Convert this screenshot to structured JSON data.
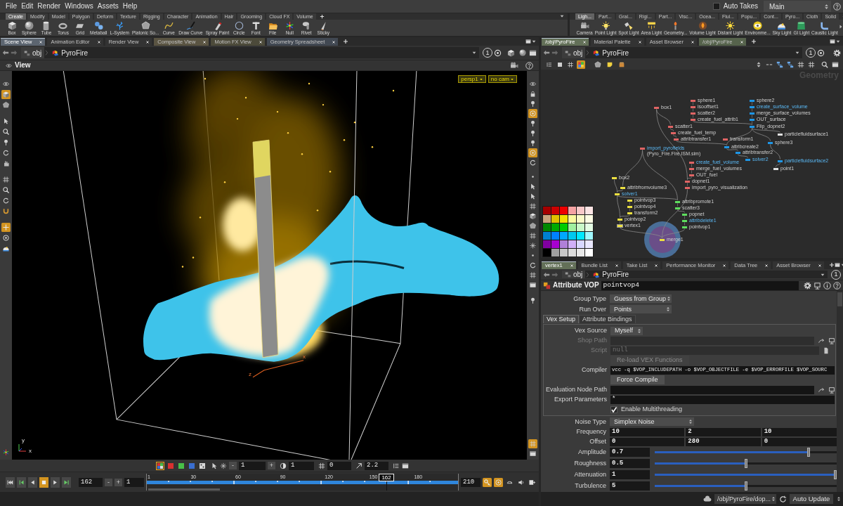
{
  "menu_bar": {
    "items": [
      "File",
      "Edit",
      "Render",
      "Windows",
      "Assets",
      "Help"
    ],
    "auto_takes": {
      "label": "Auto Takes",
      "checked": false
    },
    "desktop": "Main"
  },
  "shelf_left": {
    "tabs": [
      {
        "label": "Create",
        "selected": true
      },
      {
        "label": "Modify",
        "selected": false
      },
      {
        "label": "Model",
        "selected": false
      },
      {
        "label": "Polygon",
        "selected": false
      },
      {
        "label": "Deform",
        "selected": false
      },
      {
        "label": "Texture",
        "selected": false
      },
      {
        "label": "Rigging",
        "selected": false
      },
      {
        "label": "Character",
        "selected": false
      },
      {
        "label": "Animation",
        "selected": false
      },
      {
        "label": "Hair",
        "selected": false
      },
      {
        "label": "Grooming",
        "selected": false
      },
      {
        "label": "Cloud FX",
        "selected": false
      },
      {
        "label": "Volume",
        "selected": false
      }
    ],
    "tools": [
      "Box",
      "Sphere",
      "Tube",
      "Torus",
      "Grid",
      "Metaball",
      "L-System",
      "Platonic So...",
      "Curve",
      "Draw Curve",
      "Spray Paint",
      "Circle",
      "Font",
      "File",
      "Null",
      "Rivet",
      "Sticky"
    ]
  },
  "shelf_right": {
    "tabs": [
      {
        "label": "Ligh...",
        "selected": true
      },
      {
        "label": "Part...",
        "selected": false
      },
      {
        "label": "Grai...",
        "selected": false
      },
      {
        "label": "Rigi...",
        "selected": false
      },
      {
        "label": "Part...",
        "selected": false
      },
      {
        "label": "Visc...",
        "selected": false
      },
      {
        "label": "Ocea...",
        "selected": false
      },
      {
        "label": "Flui...",
        "selected": false
      },
      {
        "label": "Popu...",
        "selected": false
      },
      {
        "label": "Cont...",
        "selected": false
      },
      {
        "label": "Pyro...",
        "selected": false
      },
      {
        "label": "Cloth",
        "selected": false
      },
      {
        "label": "Solid",
        "selected": false
      }
    ],
    "tools": [
      "Camera",
      "Point Light",
      "Spot Light",
      "Area Light",
      "Geometry...",
      "Volume Light",
      "Distant Light",
      "Environme...",
      "Sky Light",
      "GI Light",
      "Caustic Light"
    ]
  },
  "scene_view": {
    "tabs": [
      {
        "label": "Scene View",
        "selected": true,
        "color": "#5c6570"
      },
      {
        "label": "Animation Editor",
        "selected": false,
        "color": "#333333"
      },
      {
        "label": "Render View",
        "selected": false,
        "color": "#333333"
      },
      {
        "label": "Composite View",
        "selected": false,
        "color": "#5a5442"
      },
      {
        "label": "Motion FX View",
        "selected": false,
        "color": "#4c4a3a"
      },
      {
        "label": "Geometry Spreadsheet",
        "selected": false,
        "color": "#414852"
      }
    ],
    "path": [
      "obj",
      "PyroFire"
    ],
    "link": "1",
    "title": "View",
    "camera": "persp1",
    "camera_menu": "no cam",
    "left_tools": [
      {
        "selected": false
      },
      {
        "selected": true
      },
      {
        "selected": false
      },
      {
        "selected": false
      },
      {
        "selected": false
      },
      {
        "selected": false
      },
      {
        "selected": false
      },
      {
        "selected": false
      },
      {
        "selected": false
      },
      {
        "selected": false
      },
      {
        "selected": false
      },
      {
        "selected": false
      },
      {
        "selected": true
      },
      {
        "selected": false
      },
      {
        "selected": false
      },
      {
        "selected": false
      }
    ],
    "right_tools": [
      {
        "selected": false
      },
      {
        "selected": false
      },
      {
        "selected": false
      },
      {
        "selected": true
      },
      {
        "selected": false
      },
      {
        "selected": false
      },
      {
        "selected": false
      },
      {
        "selected": true
      },
      {
        "selected": false
      },
      {
        "selected": false
      },
      {
        "selected": false
      },
      {
        "selected": false
      },
      {
        "selected": false
      },
      {
        "selected": false
      },
      {
        "selected": false
      },
      {
        "selected": false
      },
      {
        "selected": false
      },
      {
        "selected": false
      },
      {
        "selected": false
      },
      {
        "selected": false
      },
      {
        "selected": false
      },
      {
        "selected": false
      },
      {
        "selected": true
      },
      {
        "selected": false
      }
    ],
    "handle_axes": [
      "x",
      "z"
    ],
    "axis_labels": [
      "y",
      "x"
    ]
  },
  "display_bar": {
    "channels": [
      {
        "selected": true
      },
      {
        "selected": false
      },
      {
        "selected": false
      },
      {
        "selected": false
      },
      {
        "selected": false
      }
    ],
    "step_buttons": [
      "-",
      "+"
    ],
    "fields": [
      "1",
      "1",
      "0",
      "2.2"
    ]
  },
  "timeline": {
    "buttons": [
      {
        "selected": false
      },
      {
        "selected": false
      },
      {
        "selected": false
      },
      {
        "selected": true
      },
      {
        "selected": false
      },
      {
        "selected": false
      }
    ],
    "frame": "162",
    "step_buttons": [
      "-",
      "+"
    ],
    "start": "1",
    "ticks": [
      "1",
      "30",
      "60",
      "90",
      "120",
      "150",
      "180"
    ],
    "marker": "162",
    "level": 0.77,
    "end": "210",
    "options": [
      {
        "selected": true
      },
      {
        "selected": true
      },
      {
        "selected": false
      },
      {
        "selected": false
      },
      {
        "selected": false
      }
    ]
  },
  "network": {
    "tabs": [
      {
        "label": "/obj/PyroFire",
        "selected": true,
        "color": "#637058"
      },
      {
        "label": "Material Palette",
        "selected": false,
        "color": "#333333"
      },
      {
        "label": "Asset Browser",
        "selected": false,
        "color": "#333333"
      },
      {
        "label": "/obj/PyroFire",
        "selected": false,
        "color": "#56634c"
      }
    ],
    "path": [
      "obj",
      "PyroFire"
    ],
    "link": "1",
    "view_modes": [
      {
        "selected": false
      },
      {
        "selected": false
      },
      {
        "selected": false
      },
      {
        "selected": true
      }
    ],
    "context": "Geometry",
    "nodes": [
      {
        "label": "box1",
        "color": "#e06464",
        "highlighted": false,
        "selected": false
      },
      {
        "label": "sphere1",
        "color": "#e06464",
        "highlighted": false,
        "selected": false
      },
      {
        "label": "isooffset1",
        "color": "#e06464",
        "highlighted": false,
        "selected": false
      },
      {
        "label": "scatter2",
        "color": "#e06464",
        "highlighted": false,
        "selected": false
      },
      {
        "label": "create_fuel_attrib1",
        "color": "#e06464",
        "highlighted": false,
        "selected": false
      },
      {
        "label": "scatter1",
        "color": "#e06464",
        "highlighted": false,
        "selected": false
      },
      {
        "label": "create_fuel_temp",
        "color": "#e06464",
        "highlighted": false,
        "selected": false
      },
      {
        "label": "transform1",
        "color": "#e06464",
        "highlighted": false,
        "selected": false
      },
      {
        "label": "attribtransfer1",
        "color": "#e06464",
        "highlighted": false,
        "selected": false
      },
      {
        "label": "import_pyrofields",
        "comment": "(Pyro_Fire.Fire.ISM.sim)",
        "color": "#e06464",
        "highlighted": true,
        "selected": false
      },
      {
        "label": "create_fuel_volume",
        "color": "#e06464",
        "highlighted": true,
        "selected": false
      },
      {
        "label": "merge_fuel_volumes",
        "color": "#e06464",
        "highlighted": false,
        "selected": false
      },
      {
        "label": "OUT_fuel",
        "color": "#e06464",
        "highlighted": false,
        "selected": false
      },
      {
        "label": "dopnet1",
        "color": "#e06464",
        "highlighted": false,
        "selected": false
      },
      {
        "label": "import_pyro_visualization",
        "color": "#e06464",
        "highlighted": false,
        "selected": false
      },
      {
        "label": "sphere2",
        "color": "#1e96e6",
        "highlighted": false,
        "selected": false
      },
      {
        "label": "create_surface_volume",
        "color": "#1e96e6",
        "highlighted": true,
        "selected": false
      },
      {
        "label": "merge_surface_volumes",
        "color": "#1e96e6",
        "highlighted": false,
        "selected": false
      },
      {
        "label": "OUT_surface",
        "color": "#1e96e6",
        "highlighted": false,
        "selected": false
      },
      {
        "label": "Flip_dopnet2",
        "color": "#1e96e6",
        "highlighted": false,
        "selected": false
      },
      {
        "label": "attribcreate2",
        "color": "#1e96e6",
        "highlighted": false,
        "selected": false
      },
      {
        "label": "attribtransfer2",
        "color": "#1e96e6",
        "highlighted": false,
        "selected": false
      },
      {
        "label": "sphere3",
        "color": "#1e96e6",
        "highlighted": false,
        "selected": false
      },
      {
        "label": "solver2",
        "color": "#1e96e6",
        "highlighted": true,
        "selected": false
      },
      {
        "label": "particlefluidsurface1",
        "color": "#e0e0e0",
        "highlighted": false,
        "selected": false
      },
      {
        "label": "particlefluidsurface2",
        "color": "#1e96e6",
        "highlighted": true,
        "selected": false
      },
      {
        "label": "point1",
        "color": "#e0e0e0",
        "highlighted": false,
        "selected": false
      },
      {
        "label": "box2",
        "color": "#ece040",
        "highlighted": false,
        "selected": false
      },
      {
        "label": "attribfromvolume3",
        "color": "#ece040",
        "highlighted": false,
        "selected": false
      },
      {
        "label": "solver1",
        "color": "#ece040",
        "highlighted": true,
        "selected": false
      },
      {
        "label": "pointvop3",
        "color": "#ece040",
        "highlighted": false,
        "selected": false
      },
      {
        "label": "pointvop4",
        "color": "#ece040",
        "highlighted": false,
        "selected": false
      },
      {
        "label": "transform2",
        "color": "#ece040",
        "highlighted": false,
        "selected": false
      },
      {
        "label": "pointvop2",
        "color": "#ece040",
        "highlighted": false,
        "selected": false
      },
      {
        "label": "vertex1",
        "color": "#ece040",
        "highlighted": false,
        "selected": true
      },
      {
        "label": "merge1",
        "color": "#ece040",
        "highlighted": false,
        "selected": false
      },
      {
        "label": "attribpromote1",
        "color": "#5ede5e",
        "highlighted": false,
        "selected": false
      },
      {
        "label": "scatter3",
        "color": "#5ede5e",
        "highlighted": false,
        "selected": false
      },
      {
        "label": "popnet",
        "color": "#5ede5e",
        "highlighted": false,
        "selected": false
      },
      {
        "label": "attribdelete1",
        "color": "#5ede5e",
        "highlighted": true,
        "selected": false
      },
      {
        "label": "pointvop1",
        "color": "#5ede5e",
        "highlighted": false,
        "selected": false
      }
    ],
    "palette": [
      {
        "color": "#a50000"
      },
      {
        "color": "#cc0000"
      },
      {
        "color": "#ee0000"
      },
      {
        "color": "#f5a3a3"
      },
      {
        "color": "#f8c8c8"
      },
      {
        "color": "#fce4e4"
      },
      {
        "color": "#c8a47e"
      },
      {
        "color": "#e0c000"
      },
      {
        "color": "#f0e000"
      },
      {
        "color": "#fafaa0"
      },
      {
        "color": "#fafac8"
      },
      {
        "color": "#fcfce4"
      },
      {
        "color": "#008800"
      },
      {
        "color": "#00aa00"
      },
      {
        "color": "#00cc00"
      },
      {
        "color": "#a0f0a0"
      },
      {
        "color": "#c8f8c8"
      },
      {
        "color": "#e4fce4"
      },
      {
        "color": "#0080d0"
      },
      {
        "color": "#0080ff"
      },
      {
        "color": "#00a8ff"
      },
      {
        "color": "#00c8f0"
      },
      {
        "color": "#00e8ff"
      },
      {
        "color": "#a0f8ff"
      },
      {
        "color": "#8000a0"
      },
      {
        "color": "#a800d0"
      },
      {
        "color": "#b080d8"
      },
      {
        "color": "#d0b0f8"
      },
      {
        "color": "#d8d8ff"
      },
      {
        "color": "#eae8ff"
      },
      {
        "color": "#000000"
      },
      {
        "color": "#a0a0a0"
      },
      {
        "color": "#c8c8c8"
      },
      {
        "color": "#dcdcdc"
      },
      {
        "color": "#e8e8e8"
      },
      {
        "color": "#ffffff"
      }
    ]
  },
  "parameters": {
    "tabs": [
      {
        "label": "vertex1",
        "selected": true,
        "color": "#637058"
      },
      {
        "label": "Bundle List",
        "selected": false,
        "color": "#333333"
      },
      {
        "label": "Take List",
        "selected": false,
        "color": "#333333"
      },
      {
        "label": "Performance Monitor",
        "selected": false,
        "color": "#333333"
      },
      {
        "label": "Data Tree",
        "selected": false,
        "color": "#333333"
      },
      {
        "label": "Asset Browser",
        "selected": false,
        "color": "#333333"
      }
    ],
    "path": [
      "obj",
      "PyroFire"
    ],
    "link": "1",
    "node_type": "Attribute VOP",
    "node_name": "pointvop4",
    "top": [
      {
        "label": "Group Type",
        "value": "Guess from Group"
      },
      {
        "label": "Run Over",
        "value": "Points"
      }
    ],
    "folders": [
      {
        "label": "Vex Setup",
        "selected": true
      },
      {
        "label": "Attribute Bindings",
        "selected": false
      }
    ],
    "vex_setup": [
      {
        "kind": "menu",
        "label": "Vex Source",
        "value": "Myself",
        "disabled": false
      },
      {
        "kind": "path",
        "label": "Shop Path",
        "disabled": true
      },
      {
        "kind": "script",
        "label": "Script",
        "value": "null",
        "disabled": true
      },
      {
        "kind": "button",
        "label": "Re-load VEX Functions",
        "disabled": true
      },
      {
        "kind": "text",
        "label": "Compiler",
        "value": "vcc -q $VOP_INCLUDEPATH -o $VOP_OBJECTFILE -e $VOP_ERRORFILE $VOP_SOURC",
        "disabled": false
      },
      {
        "kind": "button",
        "label": "Force Compile",
        "disabled": false
      },
      {
        "kind": "path",
        "label": "Evaluation Node Path",
        "disabled": false
      },
      {
        "kind": "text",
        "label": "Export Parameters",
        "value": "*",
        "disabled": false
      },
      {
        "kind": "toggle",
        "label": "Enable Multithreading",
        "checked": true,
        "disabled": false
      }
    ],
    "noise": [
      {
        "kind": "menu",
        "label": "Noise Type",
        "value": "Simplex Noise"
      },
      {
        "kind": "vector",
        "label": "Frequency",
        "values": [
          "10",
          "2",
          "10"
        ]
      },
      {
        "kind": "vector",
        "label": "Offset",
        "values": [
          "0",
          "280",
          "0"
        ]
      },
      {
        "kind": "slider",
        "label": "Amplitude",
        "value": "0.7",
        "level": 0.85
      },
      {
        "kind": "slider",
        "label": "Roughness",
        "value": "0.5",
        "level": 0.5
      },
      {
        "kind": "slider",
        "label": "Attenuation",
        "value": "1",
        "level": 1
      },
      {
        "kind": "slider",
        "label": "Turbulence",
        "value": "5",
        "level": 0.5
      }
    ]
  },
  "status_bar": {
    "path": "/obj/PyroFire/dop...",
    "update_mode": "Auto Update"
  }
}
